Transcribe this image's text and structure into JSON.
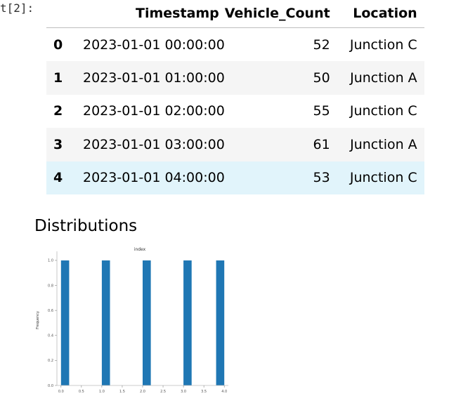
{
  "prompt": "t[2]:",
  "table": {
    "columns": [
      "Timestamp",
      "Vehicle_Count",
      "Location"
    ],
    "rows": [
      {
        "index": "0",
        "timestamp": "2023-01-01 00:00:00",
        "count": "52",
        "location": "Junction C"
      },
      {
        "index": "1",
        "timestamp": "2023-01-01 01:00:00",
        "count": "50",
        "location": "Junction A"
      },
      {
        "index": "2",
        "timestamp": "2023-01-01 02:00:00",
        "count": "55",
        "location": "Junction C"
      },
      {
        "index": "3",
        "timestamp": "2023-01-01 03:00:00",
        "count": "61",
        "location": "Junction A"
      },
      {
        "index": "4",
        "timestamp": "2023-01-01 04:00:00",
        "count": "53",
        "location": "Junction C"
      }
    ]
  },
  "section_title": "Distributions",
  "chart_data": {
    "type": "bar",
    "title": "index",
    "xlabel": "",
    "ylabel": "Frequency",
    "xlim": [
      -0.1,
      4.1
    ],
    "ylim": [
      0,
      1.05
    ],
    "xticks": [
      "0.0",
      "0.5",
      "1.0",
      "1.5",
      "2.0",
      "2.5",
      "3.0",
      "3.5",
      "4.0"
    ],
    "yticks": [
      "0.0",
      "0.2",
      "0.4",
      "0.6",
      "0.8",
      "1.0"
    ],
    "bin_width": 0.2,
    "bins": [
      {
        "x0": 0.0,
        "value": 1
      },
      {
        "x0": 1.0,
        "value": 1
      },
      {
        "x0": 2.0,
        "value": 1
      },
      {
        "x0": 3.0,
        "value": 1
      },
      {
        "x0": 3.8,
        "value": 1
      }
    ],
    "bar_color": "#1f77b4",
    "grid": false,
    "spines": [
      "left",
      "bottom"
    ]
  }
}
